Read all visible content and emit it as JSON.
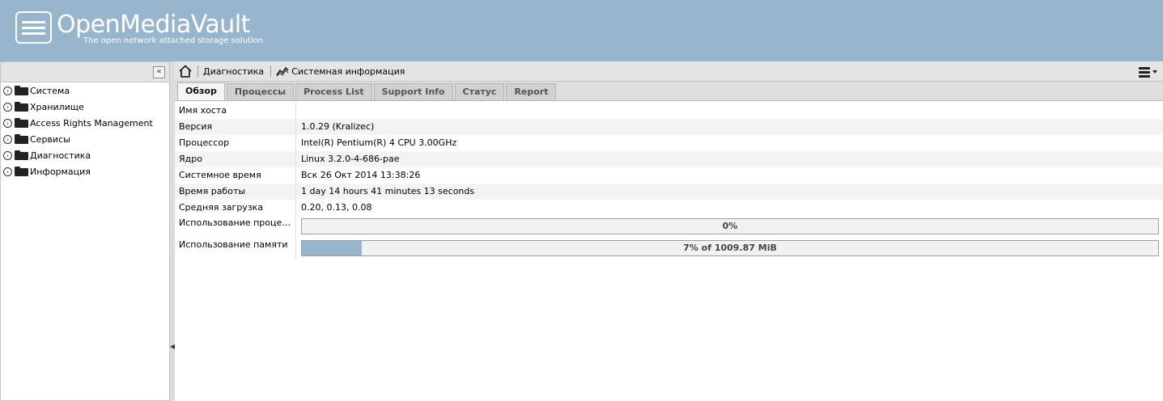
{
  "app": {
    "title": "OpenMediaVault",
    "subtitle": "The open network attached storage solution"
  },
  "sidebar": {
    "collapse_glyph": "«",
    "items": [
      {
        "label": "Система"
      },
      {
        "label": "Хранилище"
      },
      {
        "label": "Access Rights Management"
      },
      {
        "label": "Сервисы"
      },
      {
        "label": "Диагностика"
      },
      {
        "label": "Информация"
      }
    ]
  },
  "breadcrumb": {
    "items": [
      "Диагностика",
      "Системная информация"
    ]
  },
  "tabs": [
    {
      "label": "Обзор",
      "active": true
    },
    {
      "label": "Процессы",
      "active": false
    },
    {
      "label": "Process List",
      "active": false
    },
    {
      "label": "Support Info",
      "active": false
    },
    {
      "label": "Статус",
      "active": false
    },
    {
      "label": "Report",
      "active": false
    }
  ],
  "properties": [
    {
      "name": "Имя хоста",
      "value": ""
    },
    {
      "name": "Версия",
      "value": "1.0.29 (Kralizec)"
    },
    {
      "name": "Процессор",
      "value": "Intel(R) Pentium(R) 4 CPU 3.00GHz"
    },
    {
      "name": "Ядро",
      "value": "Linux 3.2.0-4-686-pae"
    },
    {
      "name": "Системное время",
      "value": "Вск 26 Окт 2014 13:38:26"
    },
    {
      "name": "Время работы",
      "value": "1 day 14 hours 41 minutes 13 seconds"
    },
    {
      "name": "Средняя загрузка",
      "value": "0.20, 0.13, 0.08"
    }
  ],
  "cpu_usage": {
    "name": "Использование процессора",
    "text": "0%",
    "percent": 0
  },
  "memory_usage": {
    "name": "Использование памяти",
    "text": "7% of 1009.87 MiB",
    "percent": 7
  },
  "colors": {
    "header": "#98b5ce",
    "bar_fill": "#98b5ce"
  }
}
